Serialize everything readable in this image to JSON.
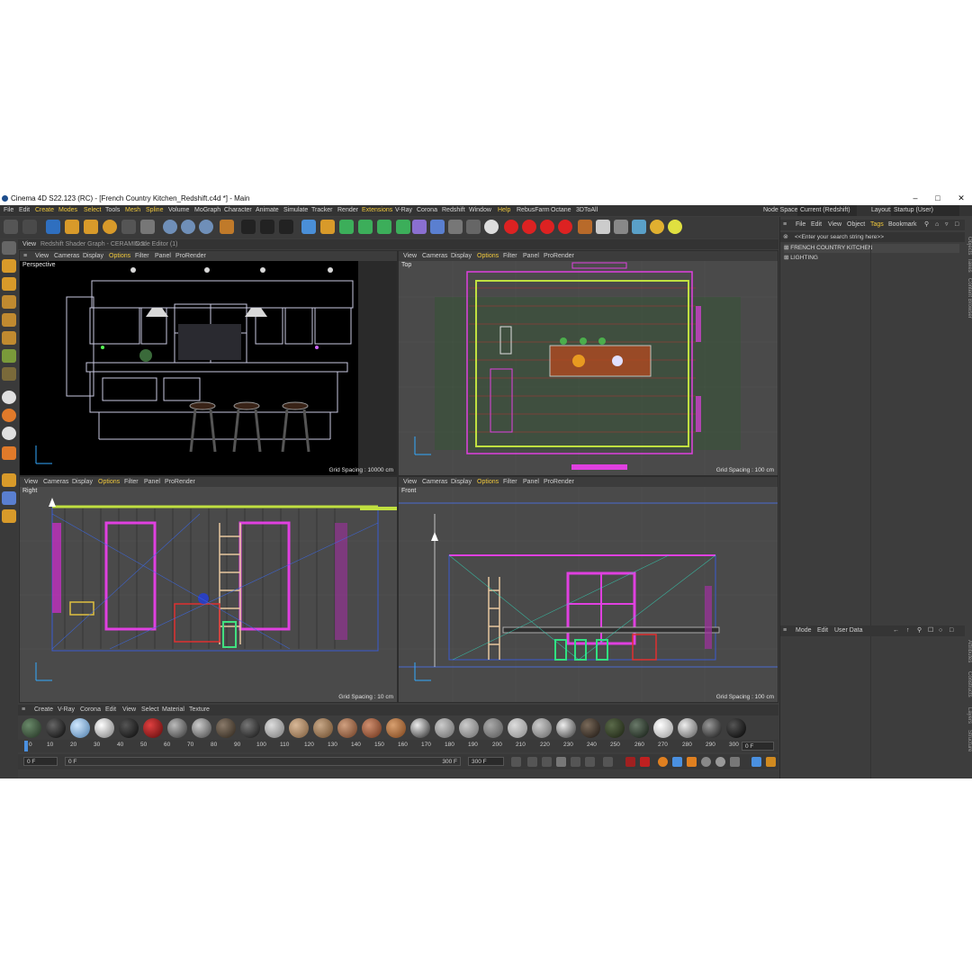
{
  "title_bar": {
    "title": "Cinema 4D S22.123 (RC) - [French Country Kitchen_Redshift.c4d *] - Main"
  },
  "menu": {
    "items": [
      "File",
      "Edit",
      "Create",
      "Modes",
      "Select",
      "Tools",
      "Mesh",
      "Spline",
      "Volume",
      "MoGraph",
      "Character",
      "Animate",
      "Simulate",
      "Tracker",
      "Render",
      "Extensions",
      "V-Ray",
      "Corona",
      "Redshift",
      "Window",
      "Help",
      "RebusFarm",
      "Octane",
      "3DToAll"
    ],
    "node_space_label": "Node Space:",
    "node_space_value": "Current (Redshift)",
    "layout_label": "Layout:",
    "layout_value": "Startup (User)"
  },
  "tabs": {
    "t1": "View",
    "t2": "Redshift Shader Graph - CERAMIC 5",
    "t3": "Node Editor (1)"
  },
  "viewport_menu": {
    "view": "View",
    "cameras": "Cameras",
    "display": "Display",
    "options": "Options",
    "filter": "Filter",
    "panel": "Panel",
    "prorender": "ProRender"
  },
  "viewports": {
    "perspective": {
      "label": "Perspective",
      "grid": "Grid Spacing : 10000 cm"
    },
    "top": {
      "label": "Top",
      "grid": "Grid Spacing : 100 cm"
    },
    "right": {
      "label": "Right",
      "grid": "Grid Spacing : 10 cm"
    },
    "front": {
      "label": "Front",
      "grid": "Grid Spacing : 100 cm"
    }
  },
  "object_manager": {
    "menu": {
      "file": "File",
      "edit": "Edit",
      "view": "View",
      "object": "Object",
      "tags": "Tags",
      "bookmark": "Bookmark"
    },
    "search_placeholder": "<<Enter your search string here>>",
    "objects": [
      "FRENCH COUNTRY KITCHEN",
      "LIGHTING"
    ]
  },
  "attributes": {
    "mode": "Mode",
    "edit": "Edit",
    "user_data": "User Data"
  },
  "side_tabs": {
    "objects": "Objects",
    "takes": "Takes",
    "content_browser": "Content Browser",
    "attributes": "Attributes",
    "constructs": "Constructs",
    "layers": "Layers",
    "structure": "Structure"
  },
  "material_manager": {
    "menu": {
      "create": "Create",
      "vray": "V-Ray",
      "corona": "Corona",
      "edit": "Edit",
      "view": "View",
      "select": "Select",
      "material": "Material",
      "texture": "Texture"
    }
  },
  "timeline": {
    "ticks": [
      "0",
      "10",
      "20",
      "30",
      "40",
      "50",
      "60",
      "70",
      "80",
      "90",
      "100",
      "110",
      "120",
      "130",
      "140",
      "150",
      "160",
      "170",
      "180",
      "190",
      "200",
      "210",
      "220",
      "230",
      "240",
      "250",
      "260",
      "270",
      "280",
      "290",
      "300"
    ],
    "current_frame": "0 F"
  },
  "transport": {
    "start": "0 F",
    "range_start": "0 F",
    "range_end": "300 F",
    "end": "300 F"
  }
}
